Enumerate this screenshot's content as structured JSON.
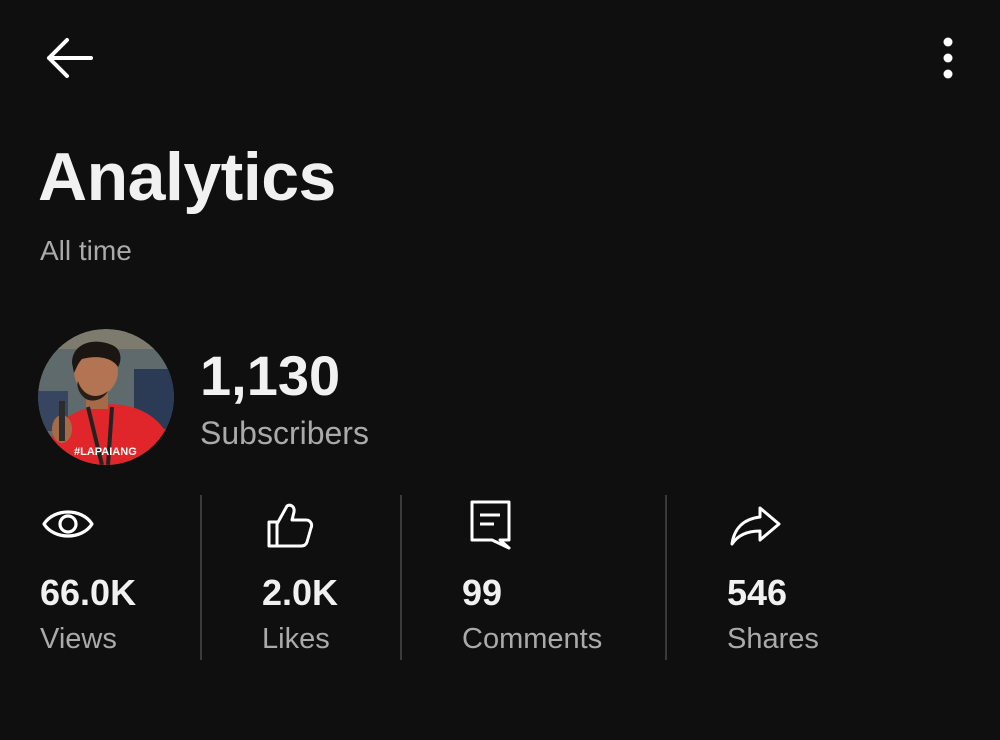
{
  "header": {
    "back_icon": "arrow-left-icon",
    "menu_icon": "more-vertical-icon"
  },
  "page": {
    "title": "Analytics",
    "subtitle": "All time"
  },
  "channel": {
    "subscriber_count": "1,130",
    "subscriber_label": "Subscribers",
    "avatar_badge_text": "#LAPAIANG"
  },
  "stats": {
    "views": {
      "icon": "eye-icon",
      "value": "66.0K",
      "label": "Views"
    },
    "likes": {
      "icon": "thumbs-up-icon",
      "value": "2.0K",
      "label": "Likes"
    },
    "comments": {
      "icon": "comment-icon",
      "value": "99",
      "label": "Comments"
    },
    "shares": {
      "icon": "share-icon",
      "value": "546",
      "label": "Shares"
    }
  },
  "colors": {
    "background": "#0f0f0f",
    "primary_text": "#f1f1f1",
    "secondary_text": "#aaaaaa",
    "divider": "#3a3a3a",
    "avatar_shirt": "#e0262b"
  }
}
